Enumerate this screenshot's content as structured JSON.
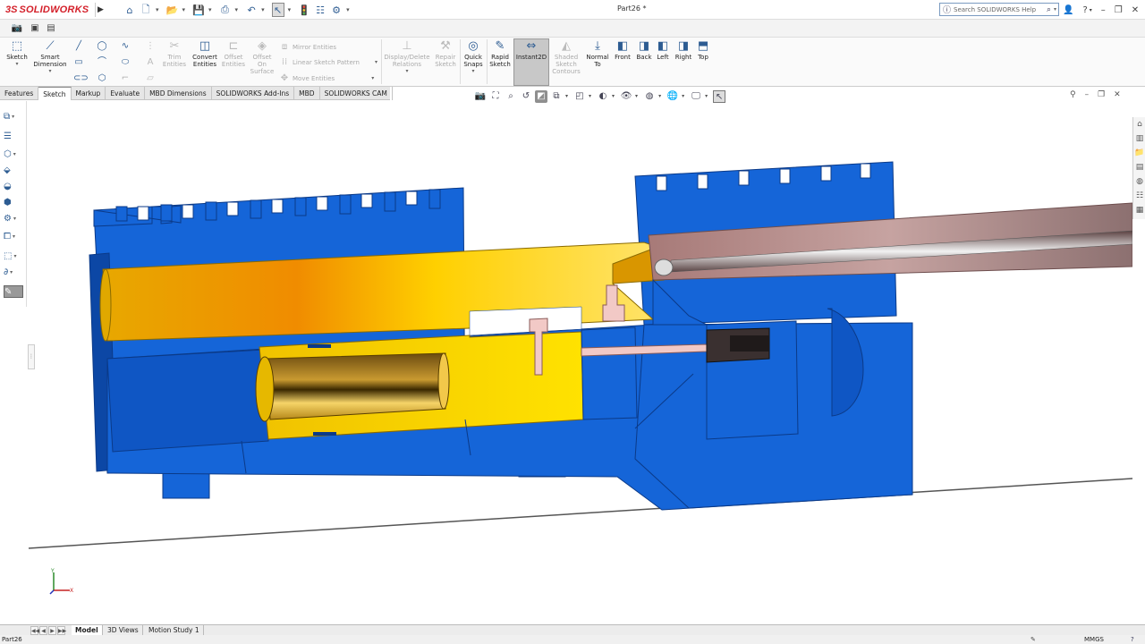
{
  "app": {
    "logo_prefix": "3S",
    "logo_name": "SOLIDWORKS",
    "document_title": "Part26 *"
  },
  "quick_access": {
    "icons": [
      "home-icon",
      "new-document-icon",
      "open-icon",
      "save-icon",
      "print-icon",
      "undo-icon",
      "select-icon",
      "rebuild-icon",
      "file-properties-icon",
      "options-icon"
    ]
  },
  "search": {
    "placeholder": "Search SOLIDWORKS Help"
  },
  "window_controls": [
    "user-icon",
    "help-icon",
    "minimize-icon",
    "restore-icon",
    "close-icon"
  ],
  "command_manager": {
    "sketch": "Sketch",
    "smart_dimension": [
      "Smart",
      "Dimension"
    ],
    "trim_entities": [
      "Trim",
      "Entities"
    ],
    "convert_entities": [
      "Convert",
      "Entities"
    ],
    "offset_entities": [
      "Offset",
      "Entities"
    ],
    "offset_on_surface": [
      "Offset",
      "On",
      "Surface"
    ],
    "mirror_entities": "Mirror Entities",
    "linear_sketch_pattern": "Linear Sketch Pattern",
    "move_entities": "Move Entities",
    "display_delete_relations": [
      "Display/Delete",
      "Relations"
    ],
    "repair_sketch": [
      "Repair",
      "Sketch"
    ],
    "quick_snaps": [
      "Quick",
      "Snaps"
    ],
    "rapid_sketch": [
      "Rapid",
      "Sketch"
    ],
    "instant2d": "Instant2D",
    "shaded_sketch_contours": [
      "Shaded",
      "Sketch",
      "Contours"
    ],
    "normal_to": [
      "Normal",
      "To"
    ],
    "front": "Front",
    "back": "Back",
    "left": "Left",
    "right": "Right",
    "top": "Top"
  },
  "tabs": [
    "Features",
    "Sketch",
    "Markup",
    "Evaluate",
    "MBD Dimensions",
    "SOLIDWORKS Add-Ins",
    "MBD",
    "SOLIDWORKS CAM"
  ],
  "active_tab": "Sketch",
  "bottom_tabs": [
    "Model",
    "3D Views",
    "Motion Study 1"
  ],
  "active_bottom_tab": "Model",
  "status": {
    "left": "Part26",
    "units": "MMGS"
  },
  "triad": {
    "x": "X",
    "y": "Y"
  },
  "colors": {
    "part_blue": "#1565d8",
    "part_blue_dark": "#0c47a5",
    "section_yellow": "#f5c400",
    "barrel_rose": "#b79290",
    "accent_red": "#d4202a",
    "background": "#ffffff"
  }
}
